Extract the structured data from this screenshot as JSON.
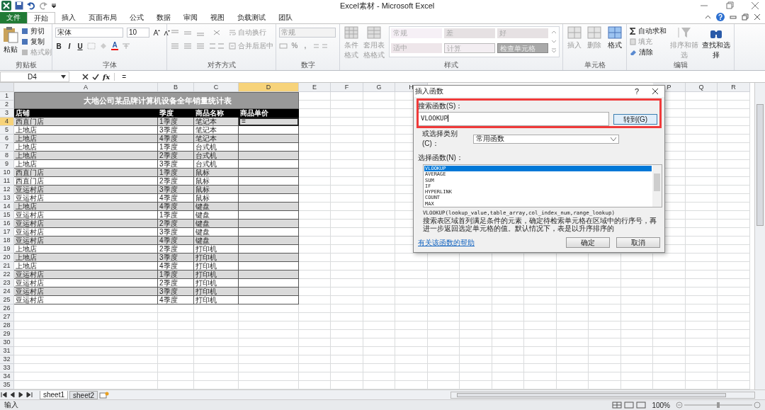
{
  "window": {
    "title": "Excel素材 - Microsoft Excel"
  },
  "ribbon_tabs": [
    {
      "label": "文件",
      "kind": "file",
      "selected": false
    },
    {
      "label": "开始",
      "kind": "tab",
      "selected": true
    },
    {
      "label": "插入",
      "kind": "tab",
      "selected": false
    },
    {
      "label": "页面布局",
      "kind": "tab",
      "selected": false
    },
    {
      "label": "公式",
      "kind": "tab",
      "selected": false
    },
    {
      "label": "数据",
      "kind": "tab",
      "selected": false
    },
    {
      "label": "审阅",
      "kind": "tab",
      "selected": false
    },
    {
      "label": "视图",
      "kind": "tab",
      "selected": false
    },
    {
      "label": "负载测试",
      "kind": "tab",
      "selected": false
    },
    {
      "label": "团队",
      "kind": "tab",
      "selected": false
    }
  ],
  "clipboard": {
    "label": "剪贴板",
    "paste": "粘贴",
    "tools": [
      {
        "label": "剪切",
        "disabled": false
      },
      {
        "label": "复制",
        "disabled": false
      },
      {
        "label": "格式刷",
        "disabled": true
      }
    ]
  },
  "font": {
    "label": "字体",
    "name": "宋体",
    "size": "10",
    "styles": [
      "B",
      "I",
      "U"
    ],
    "color_letter": "A"
  },
  "alignment": {
    "label": "对齐方式",
    "wrap": "自动换行",
    "merge": "合并后居中"
  },
  "number": {
    "label": "数字",
    "format": "常规",
    "symbols": [
      "%",
      ","
    ]
  },
  "styles": {
    "label": "样式",
    "conditional": "条件格式",
    "table_format": "套用表格格式",
    "cell_styles": [
      {
        "label": "常规",
        "kind": "normal"
      },
      {
        "label": "差",
        "kind": "bad"
      },
      {
        "label": "好",
        "kind": "good"
      },
      {
        "label": "适中",
        "kind": "neutral"
      },
      {
        "label": "计算",
        "kind": "calc"
      },
      {
        "label": "检查单元格",
        "kind": "check"
      }
    ]
  },
  "cells": {
    "label": "单元格",
    "buttons": [
      {
        "label": "插入",
        "disabled": true
      },
      {
        "label": "删除",
        "disabled": true
      },
      {
        "label": "格式",
        "disabled": false
      }
    ]
  },
  "editing": {
    "label": "编辑",
    "tools": [
      {
        "label": "自动求和",
        "kind": "sum",
        "disabled": false
      },
      {
        "label": "填充",
        "kind": "fill",
        "disabled": true
      },
      {
        "label": "清除",
        "kind": "clear",
        "disabled": false
      }
    ],
    "buttons": [
      {
        "label": "排序和筛选",
        "kind": "sort",
        "disabled": true
      },
      {
        "label": "查找和选择",
        "kind": "find",
        "disabled": false
      }
    ]
  },
  "formula_bar": {
    "name_box": "D4",
    "fx": "fx",
    "formula": "="
  },
  "sheet": {
    "columns": [
      {
        "label": "A",
        "selected": false
      },
      {
        "label": "B",
        "selected": false
      },
      {
        "label": "C",
        "selected": false
      },
      {
        "label": "D",
        "selected": true
      },
      {
        "label": "E",
        "selected": false
      },
      {
        "label": "F",
        "selected": false
      },
      {
        "label": "G",
        "selected": false
      },
      {
        "label": "H",
        "selected": false
      },
      {
        "label": "P",
        "selected": false
      },
      {
        "label": "Q",
        "selected": false
      },
      {
        "label": "R",
        "selected": false
      }
    ],
    "row_headers": [
      {
        "label": "1",
        "selected": false
      },
      {
        "label": "2",
        "selected": false
      },
      {
        "label": "3",
        "selected": false
      },
      {
        "label": "4",
        "selected": true
      },
      {
        "label": "5",
        "selected": false
      },
      {
        "label": "6",
        "selected": false
      },
      {
        "label": "7",
        "selected": false
      },
      {
        "label": "8",
        "selected": false
      },
      {
        "label": "9",
        "selected": false
      },
      {
        "label": "10",
        "selected": false
      },
      {
        "label": "11",
        "selected": false
      },
      {
        "label": "12",
        "selected": false
      },
      {
        "label": "13",
        "selected": false
      },
      {
        "label": "14",
        "selected": false
      },
      {
        "label": "15",
        "selected": false
      },
      {
        "label": "16",
        "selected": false
      },
      {
        "label": "17",
        "selected": false
      },
      {
        "label": "18",
        "selected": false
      },
      {
        "label": "19",
        "selected": false
      },
      {
        "label": "20",
        "selected": false
      },
      {
        "label": "21",
        "selected": false
      },
      {
        "label": "22",
        "selected": false
      },
      {
        "label": "23",
        "selected": false
      },
      {
        "label": "24",
        "selected": false
      },
      {
        "label": "25",
        "selected": false
      },
      {
        "label": "26",
        "selected": false
      },
      {
        "label": "27",
        "selected": false
      },
      {
        "label": "28",
        "selected": false
      },
      {
        "label": "29",
        "selected": false
      },
      {
        "label": "30",
        "selected": false
      },
      {
        "label": "31",
        "selected": false
      },
      {
        "label": "32",
        "selected": false
      },
      {
        "label": "33",
        "selected": false
      },
      {
        "label": "34",
        "selected": false
      },
      {
        "label": "35",
        "selected": false
      }
    ],
    "title": "大地公司某品牌计算机设备全年销量统计表",
    "header": [
      "店铺",
      "季度",
      "商品名称",
      "商品单价"
    ],
    "formula_entry": "=",
    "rows": [
      {
        "cells": [
          "西直门店",
          "1季度",
          "笔记本"
        ],
        "shaded": true
      },
      {
        "cells": [
          "上地店",
          "3季度",
          "笔记本"
        ],
        "shaded": false
      },
      {
        "cells": [
          "上地店",
          "4季度",
          "笔记本"
        ],
        "shaded": true
      },
      {
        "cells": [
          "上地店",
          "1季度",
          "台式机"
        ],
        "shaded": false
      },
      {
        "cells": [
          "上地店",
          "2季度",
          "台式机"
        ],
        "shaded": true
      },
      {
        "cells": [
          "上地店",
          "3季度",
          "台式机"
        ],
        "shaded": false
      },
      {
        "cells": [
          "西直门店",
          "1季度",
          "鼠标"
        ],
        "shaded": true
      },
      {
        "cells": [
          "西直门店",
          "2季度",
          "鼠标"
        ],
        "shaded": false
      },
      {
        "cells": [
          "亚运村店",
          "3季度",
          "鼠标"
        ],
        "shaded": true
      },
      {
        "cells": [
          "亚运村店",
          "4季度",
          "鼠标"
        ],
        "shaded": false
      },
      {
        "cells": [
          "上地店",
          "4季度",
          "键盘"
        ],
        "shaded": true
      },
      {
        "cells": [
          "亚运村店",
          "1季度",
          "键盘"
        ],
        "shaded": false
      },
      {
        "cells": [
          "亚运村店",
          "2季度",
          "键盘"
        ],
        "shaded": true
      },
      {
        "cells": [
          "亚运村店",
          "3季度",
          "键盘"
        ],
        "shaded": false
      },
      {
        "cells": [
          "亚运村店",
          "4季度",
          "键盘"
        ],
        "shaded": true
      },
      {
        "cells": [
          "上地店",
          "2季度",
          "打印机"
        ],
        "shaded": false
      },
      {
        "cells": [
          "上地店",
          "3季度",
          "打印机"
        ],
        "shaded": true
      },
      {
        "cells": [
          "上地店",
          "4季度",
          "打印机"
        ],
        "shaded": false
      },
      {
        "cells": [
          "亚运村店",
          "1季度",
          "打印机"
        ],
        "shaded": true
      },
      {
        "cells": [
          "亚运村店",
          "2季度",
          "打印机"
        ],
        "shaded": false
      },
      {
        "cells": [
          "亚运村店",
          "3季度",
          "打印机"
        ],
        "shaded": true
      },
      {
        "cells": [
          "亚运村店",
          "4季度",
          "打印机"
        ],
        "shaded": false
      }
    ]
  },
  "dialog": {
    "title": "插入函数",
    "help": "?",
    "search_label": "搜索函数(S)：",
    "search_value": "VLOOKUP",
    "highlighted": true,
    "go_button": "转到(G)",
    "category_label": "或选择类别(C)：",
    "category": "常用函数",
    "list_label": "选择函数(N)：",
    "functions": [
      {
        "label": "VLOOKUP",
        "selected": true
      },
      {
        "label": "AVERAGE",
        "selected": false
      },
      {
        "label": "SUM",
        "selected": false
      },
      {
        "label": "IF",
        "selected": false
      },
      {
        "label": "HYPERLINK",
        "selected": false
      },
      {
        "label": "COUNT",
        "selected": false
      },
      {
        "label": "MAX",
        "selected": false
      }
    ],
    "signature": "VLOOKUP(lookup_value,table_array,col_index_num,range_lookup)",
    "description": "搜索表区域首列满足条件的元素，确定待检索单元格在区域中的行序号，再进一步返回选定单元格的值。默认情况下，表是以升序排序的",
    "help_link": "有关该函数的帮助",
    "ok": "确定",
    "cancel": "取消"
  },
  "sheet_tabs": [
    {
      "label": "sheet1",
      "selected": true
    },
    {
      "label": "sheet2",
      "selected": false
    }
  ],
  "status_bar": {
    "mode": "输入",
    "zoom": "100%"
  }
}
